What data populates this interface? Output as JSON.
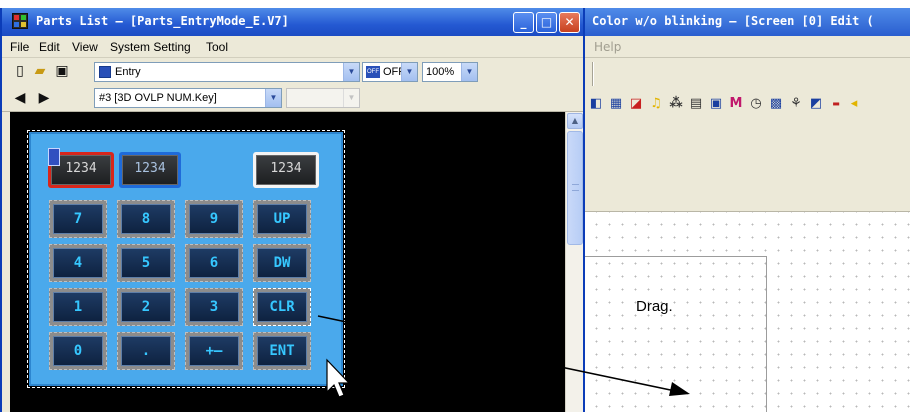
{
  "parts_window": {
    "title": "Parts List – [Parts_EntryMode_E.V7]",
    "menu": [
      "File",
      "Edit",
      "View",
      "System Setting",
      "Tool"
    ],
    "mode_combo": "Entry",
    "off_combo": "OFF",
    "zoom_combo": "100%",
    "part_combo": "#3 [3D OVLP NUM.Key]",
    "empty_combo": ""
  },
  "background_window": {
    "title": "Color w/o blinking – [Screen [0] Edit (",
    "menu_help": "Help"
  },
  "keypad": {
    "displays": [
      "1234",
      "1234",
      "1234"
    ],
    "keys": [
      [
        "7",
        "8",
        "9",
        "UP"
      ],
      [
        "4",
        "5",
        "6",
        "DW"
      ],
      [
        "1",
        "2",
        "3",
        "CLR"
      ],
      [
        "0",
        ".",
        "+–",
        "ENT"
      ]
    ]
  },
  "annotation": {
    "drag_label": "Drag."
  },
  "colors": {
    "titlebar": "#2459d2",
    "keypad_bg": "#4aa9ec",
    "key_text": "#36c7ff",
    "canvas_bg": "#000000"
  }
}
